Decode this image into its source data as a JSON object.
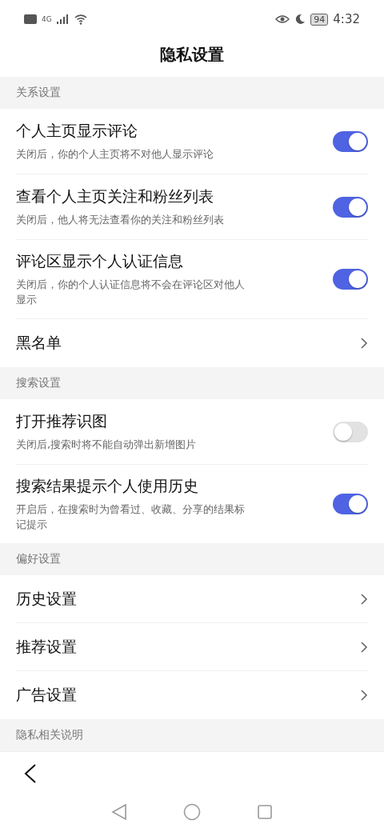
{
  "status_bar": {
    "network": "4G",
    "battery": "94",
    "time": "4:32"
  },
  "title": "隐私设置",
  "sections": [
    {
      "header": "关系设置",
      "items": [
        {
          "kind": "toggle",
          "label": "个人主页显示评论",
          "description": "关闭后，你的个人主页将不对他人显示评论",
          "on": true
        },
        {
          "kind": "toggle",
          "label": "查看个人主页关注和粉丝列表",
          "description": "关闭后，他人将无法查看你的关注和粉丝列表",
          "on": true
        },
        {
          "kind": "toggle",
          "label": "评论区显示个人认证信息",
          "description": "关闭后，你的个人认证信息将不会在评论区对他人显示",
          "on": true
        },
        {
          "kind": "link",
          "label": "黑名单"
        }
      ]
    },
    {
      "header": "搜索设置",
      "items": [
        {
          "kind": "toggle",
          "label": "打开推荐识图",
          "description": "关闭后,搜索时将不能自动弹出新增图片",
          "on": false
        },
        {
          "kind": "toggle",
          "label": "搜索结果提示个人使用历史",
          "description": "开启后，在搜索时为曾看过、收藏、分享的结果标记提示",
          "on": true
        }
      ]
    },
    {
      "header": "偏好设置",
      "items": [
        {
          "kind": "link",
          "label": "历史设置"
        },
        {
          "kind": "link",
          "label": "推荐设置"
        },
        {
          "kind": "link",
          "label": "广告设置"
        }
      ]
    },
    {
      "header": "隐私相关说明"
    }
  ]
}
